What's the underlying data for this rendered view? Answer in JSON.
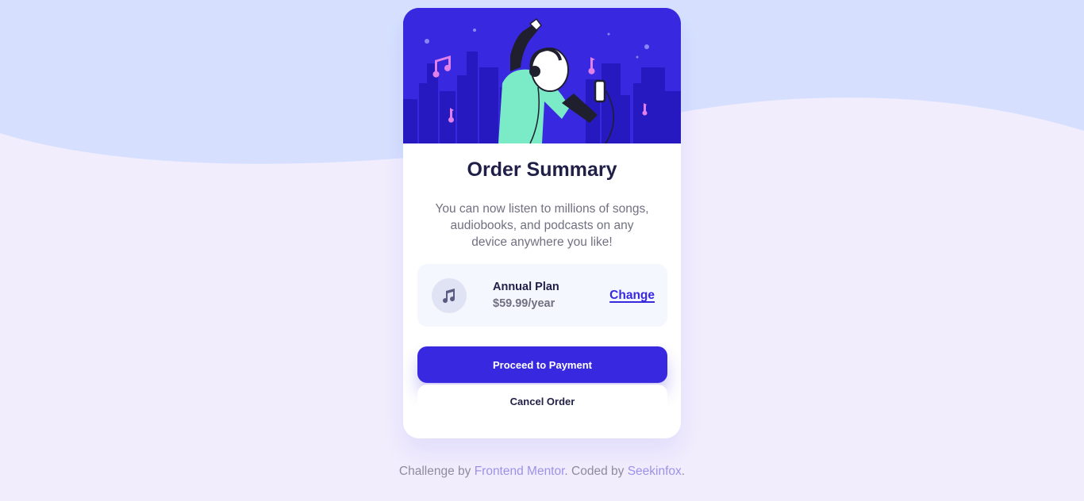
{
  "card": {
    "title": "Order Summary",
    "description": "You can now listen to millions of songs, audiobooks, and podcasts on any device anywhere you like!",
    "plan": {
      "icon": "music-note-icon",
      "name": "Annual Plan",
      "price": "$59.99/year",
      "change_label": "Change"
    },
    "proceed_label": "Proceed to Payment",
    "cancel_label": "Cancel Order",
    "hero_image": "person-dancing-with-headphones-illustration"
  },
  "footer": {
    "prefix": "Challenge by ",
    "link1": "Frontend Mentor",
    "middle": ". Coded by ",
    "link2": "Seekinfox",
    "suffix": "."
  },
  "colors": {
    "page_bg": "#f1edfd",
    "wave": "#d6e0fe",
    "accent": "#3829e0",
    "title": "#1f1f47",
    "muted": "#717082",
    "plan_bg": "#f5f7ff",
    "footer_link": "#9c92e8"
  }
}
